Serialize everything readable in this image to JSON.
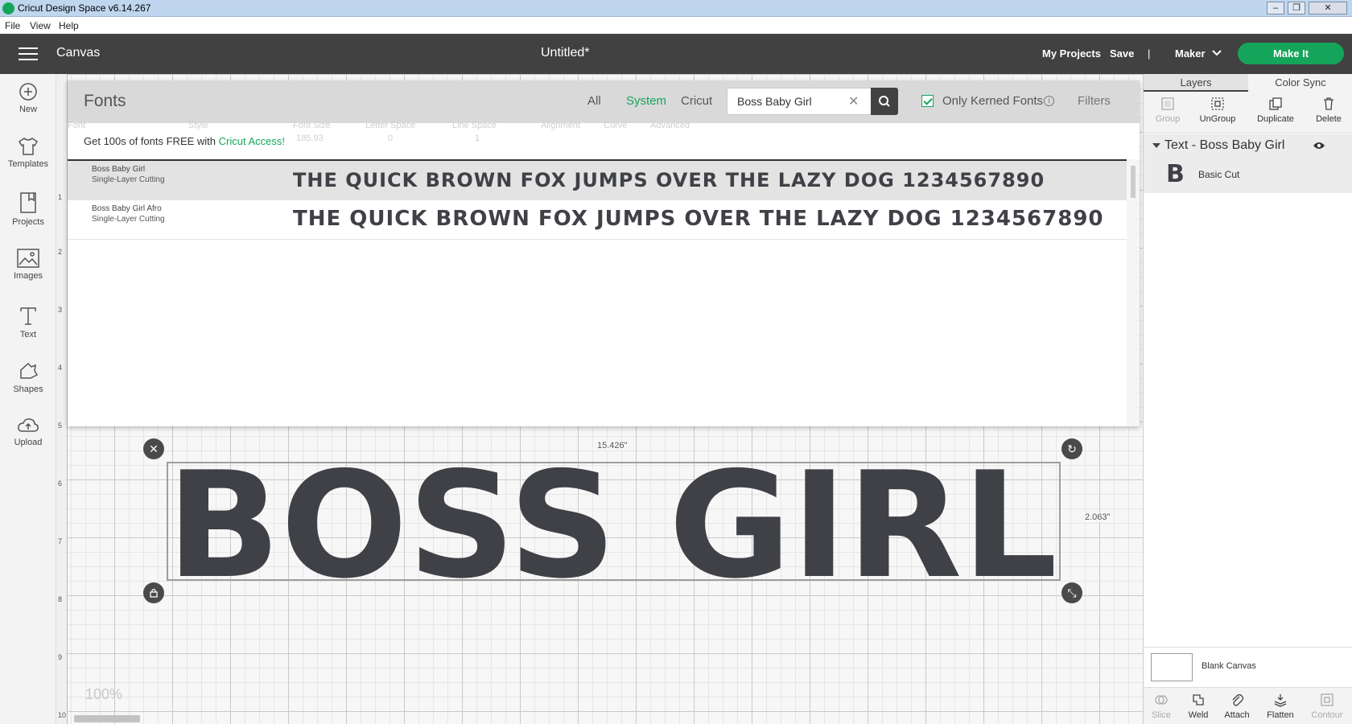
{
  "window": {
    "title": "Cricut Design Space  v6.14.267",
    "controls": [
      "–",
      "❐",
      "✕"
    ]
  },
  "menu": [
    "File",
    "View",
    "Help"
  ],
  "header": {
    "section": "Canvas",
    "doc_title": "Untitled*",
    "my_projects": "My Projects",
    "save": "Save",
    "separator": "|",
    "machine": "Maker",
    "make_it": "Make It",
    "accent_color": "#14a55a"
  },
  "sidebar": {
    "items": [
      {
        "label": "New",
        "icon": "plus-circle-icon"
      },
      {
        "label": "Templates",
        "icon": "tshirt-icon"
      },
      {
        "label": "Projects",
        "icon": "bookmark-icon"
      },
      {
        "label": "Images",
        "icon": "image-icon"
      },
      {
        "label": "Text",
        "icon": "text-icon"
      },
      {
        "label": "Shapes",
        "icon": "shapes-icon"
      },
      {
        "label": "Upload",
        "icon": "upload-cloud-icon"
      }
    ]
  },
  "fonts_panel": {
    "title": "Fonts",
    "tabs": [
      {
        "label": "All",
        "active": false
      },
      {
        "label": "System",
        "active": true
      },
      {
        "label": "Cricut",
        "active": false
      }
    ],
    "search_value": "Boss Baby Girl",
    "only_kerned_label": "Only Kerned Fonts",
    "only_kerned_checked": true,
    "filters_label": "Filters",
    "promo_text": "Get 100s of fonts FREE with ",
    "promo_link": "Cricut Access!",
    "results": [
      {
        "name": "Boss Baby Girl",
        "type": "Single-Layer Cutting",
        "sample": "THE QUICK BROWN FOX JUMPS OVER THE LAZY DOG 1234567890",
        "selected": true
      },
      {
        "name": "Boss Baby Girl Afro",
        "type": "Single-Layer Cutting",
        "sample": "THE QUICK BROWN FOX JUMPS OVER THE LAZY DOG 1234567890",
        "selected": false
      }
    ],
    "faint_toolbar": [
      "Font",
      "Style",
      "Font Size",
      "Letter Space",
      "Line Space",
      "Alignment",
      "Curve",
      "Advanced",
      "185.93",
      "0",
      "1"
    ]
  },
  "canvas": {
    "ruler_numbers": [
      "1",
      "2",
      "3",
      "4",
      "5",
      "6",
      "7",
      "8",
      "9",
      "10"
    ],
    "design_text": "BOSS GIRL",
    "width_label": "15.426\"",
    "height_label": "2.063\"",
    "zoom": "100%"
  },
  "right_panel": {
    "tabs": [
      {
        "label": "Layers",
        "active": true
      },
      {
        "label": "Color Sync",
        "active": false
      }
    ],
    "tools": [
      {
        "label": "Group",
        "enabled": false
      },
      {
        "label": "UnGroup",
        "enabled": true
      },
      {
        "label": "Duplicate",
        "enabled": true
      },
      {
        "label": "Delete",
        "enabled": true
      }
    ],
    "layer_title": "Text - Boss Baby Girl",
    "layer_glyph": "B",
    "layer_operation": "Basic Cut",
    "blank_canvas": "Blank Canvas",
    "bottom_tools": [
      {
        "label": "Slice",
        "enabled": false
      },
      {
        "label": "Weld",
        "enabled": true
      },
      {
        "label": "Attach",
        "enabled": true
      },
      {
        "label": "Flatten",
        "enabled": true
      },
      {
        "label": "Contour",
        "enabled": false
      }
    ]
  }
}
